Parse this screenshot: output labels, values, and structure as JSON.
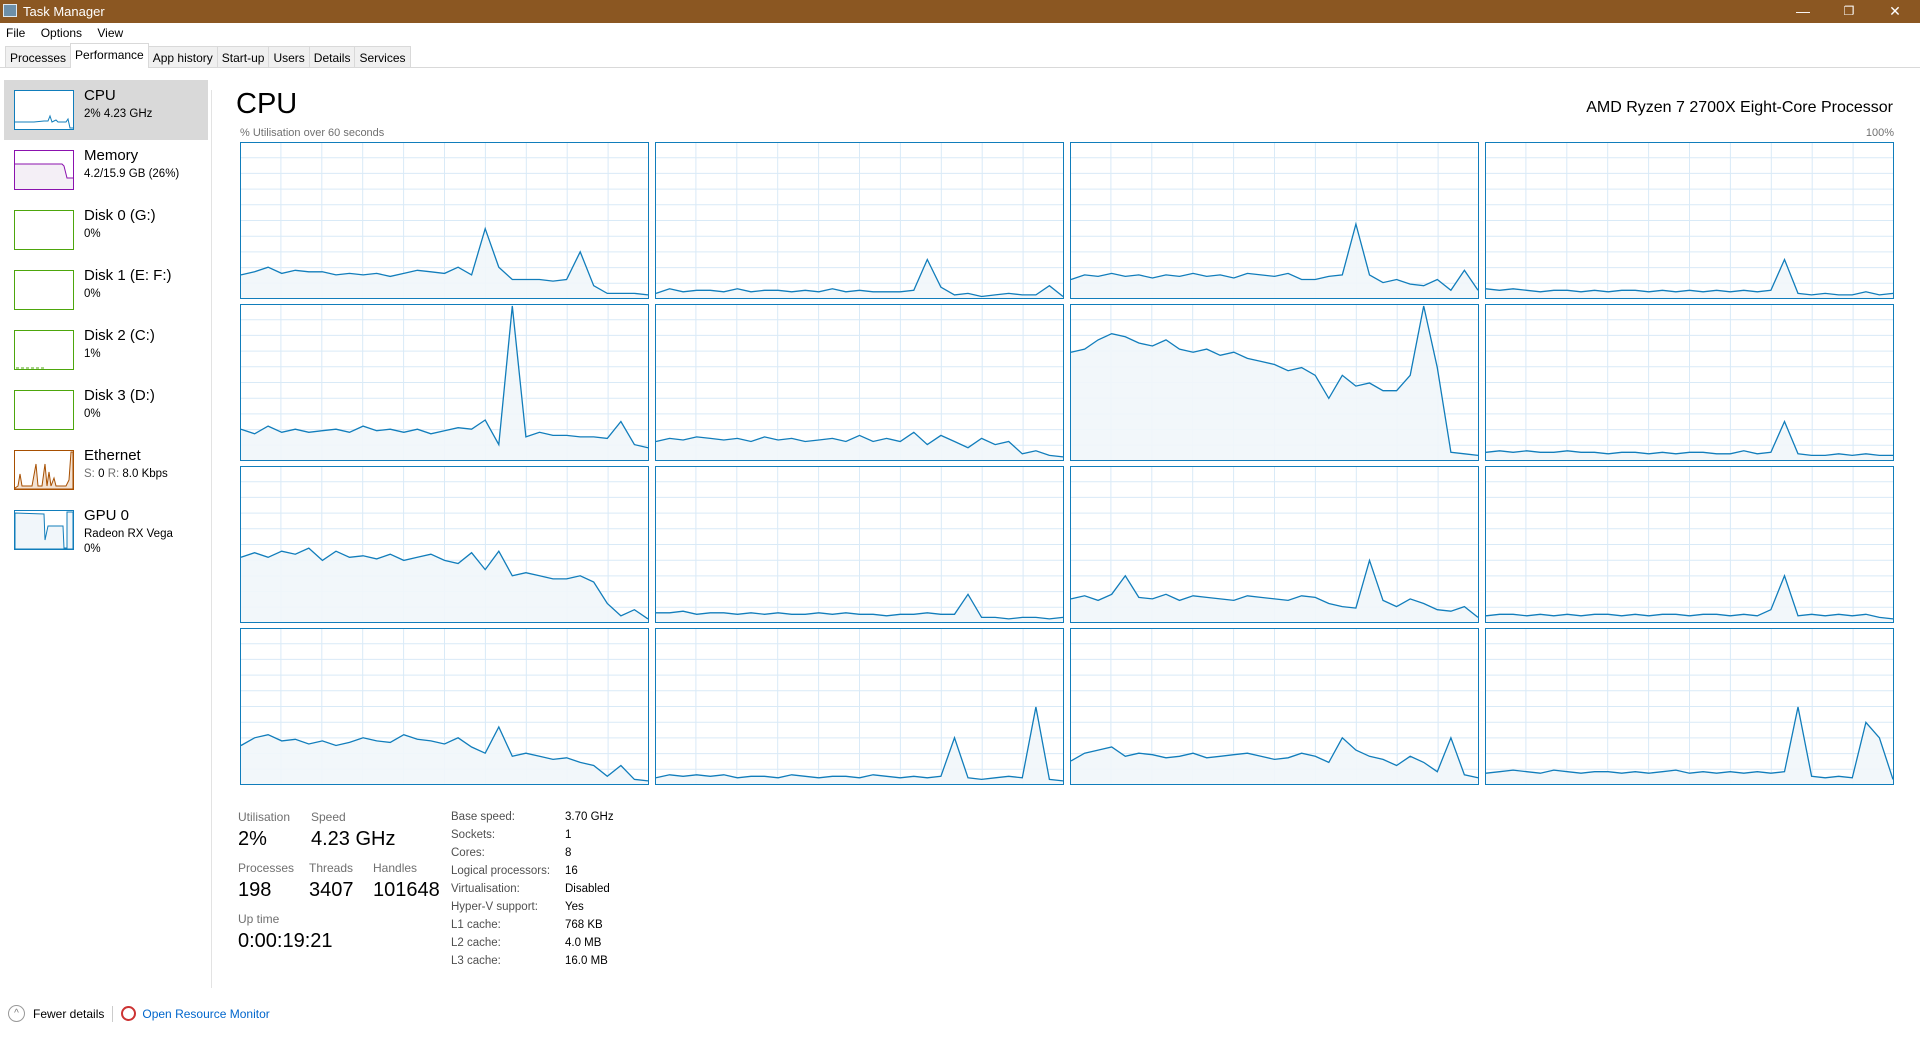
{
  "window": {
    "title": "Task Manager",
    "minimize": "—",
    "restore": "❐",
    "close": "✕"
  },
  "menu": [
    "File",
    "Options",
    "View"
  ],
  "tabs": [
    "Processes",
    "Performance",
    "App history",
    "Start-up",
    "Users",
    "Details",
    "Services"
  ],
  "active_tab": 1,
  "sidebar": [
    {
      "name": "CPU",
      "sub": "2%  4.23 GHz",
      "color": "#117dbb"
    },
    {
      "name": "Memory",
      "sub": "4.2/15.9 GB (26%)",
      "color": "#8b12ae"
    },
    {
      "name": "Disk 0 (G:)",
      "sub": "0%",
      "color": "#4da60c"
    },
    {
      "name": "Disk 1 (E: F:)",
      "sub": "0%",
      "color": "#4da60c"
    },
    {
      "name": "Disk 2 (C:)",
      "sub": "1%",
      "color": "#4da60c"
    },
    {
      "name": "Disk 3 (D:)",
      "sub": "0%",
      "color": "#4da60c"
    },
    {
      "name": "Ethernet",
      "sub_s": "S:",
      "sub_s_val": "0",
      "sub_r": "R:",
      "sub_r_val": "8.0 Kbps",
      "color": "#a74f01"
    },
    {
      "name": "GPU 0",
      "sub": "Radeon RX Vega",
      "sub2": "0%",
      "color": "#117dbb"
    }
  ],
  "main": {
    "title": "CPU",
    "model": "AMD Ryzen 7 2700X Eight-Core Processor",
    "util_label": "% Utilisation over 60 seconds",
    "max_label": "100%"
  },
  "stats": {
    "utilisation_label": "Utilisation",
    "utilisation": "2%",
    "speed_label": "Speed",
    "speed": "4.23 GHz",
    "processes_label": "Processes",
    "processes": "198",
    "threads_label": "Threads",
    "threads": "3407",
    "handles_label": "Handles",
    "handles": "101648",
    "uptime_label": "Up time",
    "uptime": "0:00:19:21"
  },
  "specs": [
    {
      "k": "Base speed:",
      "v": "3.70 GHz"
    },
    {
      "k": "Sockets:",
      "v": "1"
    },
    {
      "k": "Cores:",
      "v": "8"
    },
    {
      "k": "Logical processors:",
      "v": "16"
    },
    {
      "k": "Virtualisation:",
      "v": "Disabled"
    },
    {
      "k": "Hyper-V support:",
      "v": "Yes"
    },
    {
      "k": "L1 cache:",
      "v": "768 KB"
    },
    {
      "k": "L2 cache:",
      "v": "4.0 MB"
    },
    {
      "k": "L3 cache:",
      "v": "16.0 MB"
    }
  ],
  "footer": {
    "fewer": "Fewer details",
    "resmon": "Open Resource Monitor"
  },
  "colors": {
    "accent": "#117dbb",
    "grid": "#d9eaf7",
    "fill": "#f1f6fa"
  },
  "chart_data": {
    "type": "line",
    "title": "% Utilisation over 60 seconds",
    "ylim": [
      0,
      100
    ],
    "xlim": [
      60,
      0
    ],
    "series": [
      {
        "name": "core0",
        "values": [
          15,
          17,
          20,
          16,
          18,
          17,
          17,
          15,
          16,
          15,
          16,
          14,
          16,
          18,
          17,
          16,
          20,
          15,
          45,
          20,
          12,
          12,
          12,
          11,
          12,
          30,
          8,
          3,
          3,
          3,
          2
        ]
      },
      {
        "name": "core1",
        "values": [
          3,
          6,
          4,
          5,
          5,
          4,
          6,
          4,
          5,
          5,
          4,
          5,
          4,
          6,
          4,
          5,
          4,
          4,
          4,
          5,
          25,
          7,
          2,
          3,
          1,
          2,
          3,
          2,
          2,
          8,
          1
        ]
      },
      {
        "name": "core2",
        "values": [
          12,
          15,
          14,
          16,
          14,
          15,
          13,
          15,
          14,
          16,
          14,
          15,
          13,
          16,
          15,
          14,
          16,
          12,
          12,
          14,
          15,
          48,
          15,
          10,
          12,
          9,
          8,
          12,
          5,
          18,
          5
        ]
      },
      {
        "name": "core3",
        "values": [
          6,
          5,
          6,
          5,
          4,
          5,
          5,
          4,
          5,
          4,
          5,
          5,
          4,
          5,
          4,
          5,
          4,
          5,
          4,
          5,
          4,
          5,
          25,
          3,
          2,
          3,
          2,
          2,
          4,
          2,
          3
        ]
      },
      {
        "name": "core4",
        "values": [
          20,
          17,
          22,
          18,
          20,
          18,
          19,
          20,
          18,
          22,
          19,
          20,
          18,
          20,
          17,
          19,
          21,
          20,
          26,
          10,
          100,
          15,
          18,
          16,
          16,
          15,
          15,
          14,
          25,
          10,
          8
        ]
      },
      {
        "name": "core5",
        "values": [
          12,
          14,
          13,
          15,
          14,
          13,
          14,
          12,
          15,
          13,
          14,
          12,
          13,
          14,
          12,
          16,
          12,
          14,
          12,
          18,
          10,
          16,
          12,
          8,
          14,
          10,
          12,
          4,
          6,
          3,
          2
        ]
      },
      {
        "name": "core6",
        "values": [
          70,
          72,
          78,
          82,
          80,
          76,
          74,
          78,
          72,
          70,
          72,
          68,
          70,
          66,
          64,
          62,
          58,
          60,
          55,
          40,
          55,
          48,
          50,
          45,
          45,
          55,
          100,
          60,
          5,
          4,
          3
        ]
      },
      {
        "name": "core7",
        "values": [
          5,
          6,
          5,
          6,
          5,
          5,
          6,
          5,
          5,
          4,
          5,
          5,
          4,
          5,
          4,
          5,
          5,
          4,
          4,
          6,
          4,
          5,
          25,
          4,
          3,
          3,
          4,
          3,
          4,
          3,
          3
        ]
      },
      {
        "name": "core8",
        "values": [
          42,
          45,
          42,
          46,
          44,
          48,
          40,
          46,
          42,
          43,
          41,
          44,
          40,
          42,
          44,
          40,
          38,
          45,
          34,
          46,
          30,
          32,
          30,
          28,
          28,
          30,
          26,
          12,
          4,
          8,
          2
        ]
      },
      {
        "name": "core9",
        "values": [
          6,
          6,
          7,
          5,
          6,
          6,
          5,
          6,
          5,
          6,
          5,
          5,
          6,
          5,
          6,
          5,
          5,
          4,
          5,
          5,
          6,
          5,
          5,
          18,
          3,
          3,
          2,
          3,
          3,
          2,
          3
        ]
      },
      {
        "name": "core10",
        "values": [
          15,
          17,
          14,
          18,
          30,
          16,
          15,
          18,
          14,
          17,
          16,
          15,
          14,
          17,
          16,
          15,
          14,
          17,
          16,
          12,
          10,
          9,
          40,
          14,
          10,
          15,
          12,
          8,
          7,
          10,
          3
        ]
      },
      {
        "name": "core11",
        "values": [
          4,
          5,
          5,
          4,
          5,
          4,
          5,
          4,
          5,
          5,
          4,
          5,
          4,
          5,
          5,
          4,
          5,
          5,
          4,
          5,
          4,
          8,
          30,
          4,
          5,
          4,
          5,
          4,
          5,
          3,
          2
        ]
      },
      {
        "name": "core12",
        "values": [
          25,
          30,
          32,
          28,
          29,
          26,
          28,
          25,
          27,
          30,
          28,
          27,
          32,
          29,
          28,
          26,
          30,
          24,
          20,
          37,
          18,
          20,
          18,
          16,
          17,
          14,
          12,
          5,
          12,
          3,
          2
        ]
      },
      {
        "name": "core13",
        "values": [
          4,
          6,
          5,
          6,
          5,
          6,
          4,
          5,
          5,
          4,
          6,
          5,
          4,
          5,
          5,
          4,
          6,
          5,
          4,
          5,
          4,
          5,
          30,
          4,
          3,
          4,
          5,
          4,
          50,
          3,
          2
        ]
      },
      {
        "name": "core14",
        "values": [
          15,
          20,
          22,
          24,
          18,
          20,
          19,
          17,
          18,
          20,
          17,
          18,
          19,
          20,
          18,
          16,
          17,
          20,
          18,
          14,
          30,
          22,
          18,
          16,
          12,
          18,
          14,
          8,
          30,
          6,
          4
        ]
      },
      {
        "name": "core15",
        "values": [
          7,
          8,
          9,
          8,
          7,
          9,
          8,
          7,
          8,
          8,
          7,
          8,
          7,
          8,
          9,
          7,
          8,
          7,
          8,
          7,
          8,
          7,
          8,
          50,
          5,
          4,
          5,
          4,
          40,
          30,
          3
        ]
      }
    ]
  }
}
